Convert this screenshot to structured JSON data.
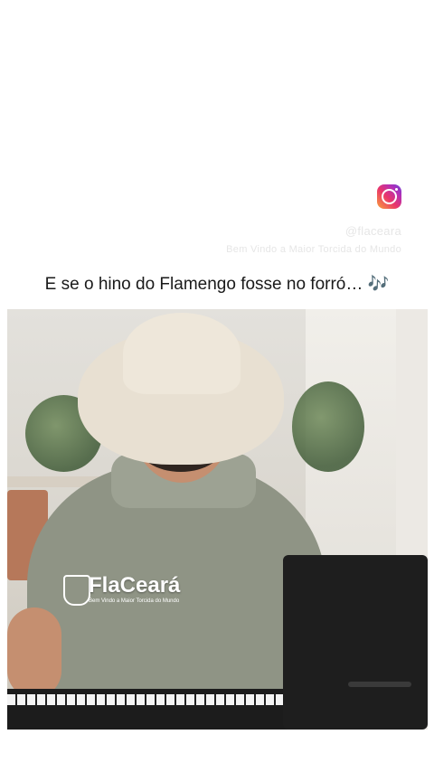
{
  "post": {
    "caption": "E se o hino do Flamengo fosse no forró… 🎶",
    "watermark_handle": "@flaceara",
    "watermark_sub": "Bem Vindo a Maior Torcida do Mundo"
  },
  "video": {
    "logo_brand": "FlaCeará",
    "logo_tagline": "Bem Vindo a Maior Torcida do Mundo"
  },
  "icons": {
    "instagram": "instagram-icon"
  },
  "colors": {
    "instagram_gradient": [
      "#f9a13a",
      "#e9356b",
      "#b42fb6",
      "#6a3fd6"
    ],
    "caption_text": "#1a1a1a"
  }
}
